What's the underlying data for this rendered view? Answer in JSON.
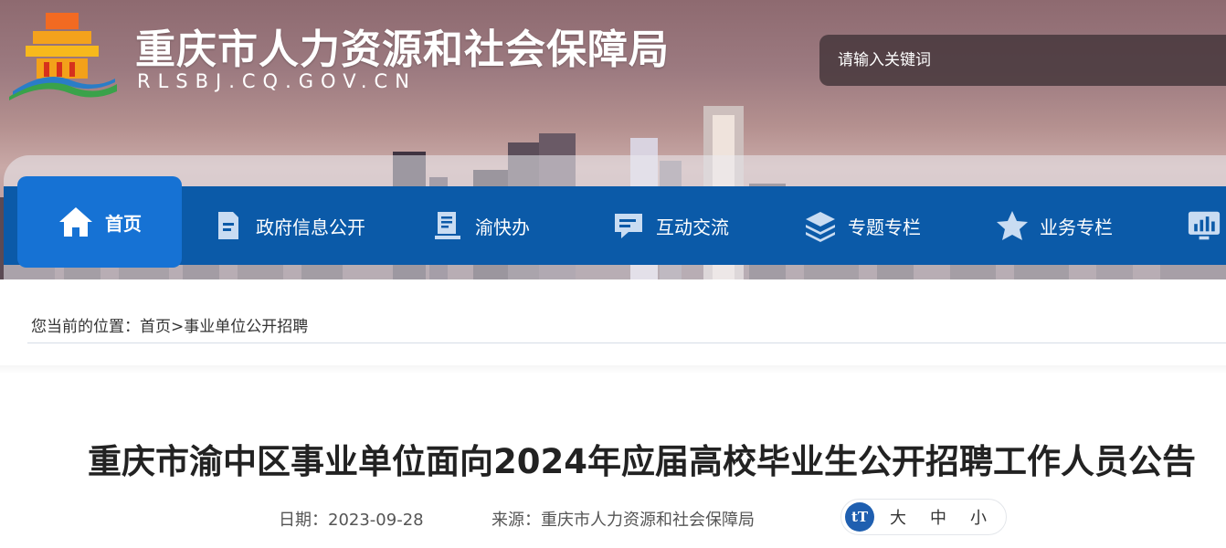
{
  "header": {
    "site_title": "重庆市人力资源和社会保障局",
    "site_domain": "RLSBJ.CQ.GOV.CN",
    "logo_icon": "emblem-logo-icon"
  },
  "search": {
    "placeholder": "请输入关键词"
  },
  "nav": {
    "items": [
      {
        "label": "首页",
        "icon": "home-icon",
        "active": true
      },
      {
        "label": "政府信息公开",
        "icon": "document-icon",
        "active": false
      },
      {
        "label": "渝快办",
        "icon": "book-stack-icon",
        "active": false
      },
      {
        "label": "互动交流",
        "icon": "chat-bubble-icon",
        "active": false
      },
      {
        "label": "专题专栏",
        "icon": "layers-icon",
        "active": false
      },
      {
        "label": "业务专栏",
        "icon": "star-icon",
        "active": false
      },
      {
        "label": "",
        "icon": "monitor-chart-icon",
        "active": false
      }
    ]
  },
  "breadcrumb": {
    "prefix": "您当前的位置：",
    "home": "首页",
    "separator": ">",
    "current": "事业单位公开招聘"
  },
  "article": {
    "title": "重庆市渝中区事业单位面向2024年应届高校毕业生公开招聘工作人员公告",
    "date": "日期：2023-09-28",
    "source": "来源：重庆市人力资源和社会保障局"
  },
  "font_size": {
    "icon_glyph": "tT",
    "large": "大",
    "medium": "中",
    "small": "小"
  },
  "colors": {
    "nav_bg": "#0b5aa8",
    "nav_active": "#1672d4",
    "accent": "#1f5fb0"
  }
}
